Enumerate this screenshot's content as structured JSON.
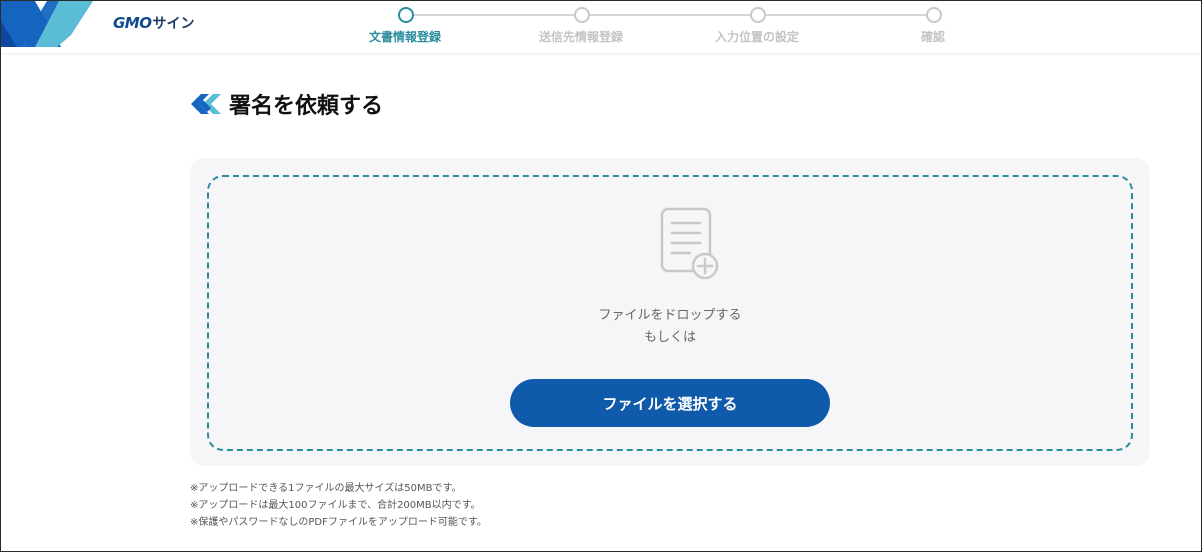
{
  "header": {
    "brand_prefix": "GMO",
    "brand_suffix": "サイン"
  },
  "stepper": {
    "steps": [
      {
        "label": "文書情報登録",
        "active": true
      },
      {
        "label": "送信先情報登録",
        "active": false
      },
      {
        "label": "入力位置の設定",
        "active": false
      },
      {
        "label": "確認",
        "active": false
      }
    ]
  },
  "page": {
    "title": "署名を依頼する"
  },
  "upload": {
    "drop_text": "ファイルをドロップする",
    "or_text": "もしくは",
    "select_button": "ファイルを選択する"
  },
  "notes": [
    "※アップロードできる1ファイルの最大サイズは50MBです。",
    "※アップロードは最大100ファイルまで、合計200MB以内です。",
    "※保護やパスワードなしのPDFファイルをアップロード可能です。"
  ],
  "colors": {
    "accent": "#2a8d9e",
    "primary_button": "#0f5aaa",
    "logo_dark": "#1565c0",
    "logo_light": "#5bbcd6",
    "panel_bg": "#f6f6f8",
    "inactive_step": "#c4c4c4"
  },
  "icons": {
    "logo": "gmo-sign-logo-icon",
    "title": "gmo-sign-mark-icon",
    "document": "document-add-icon"
  }
}
